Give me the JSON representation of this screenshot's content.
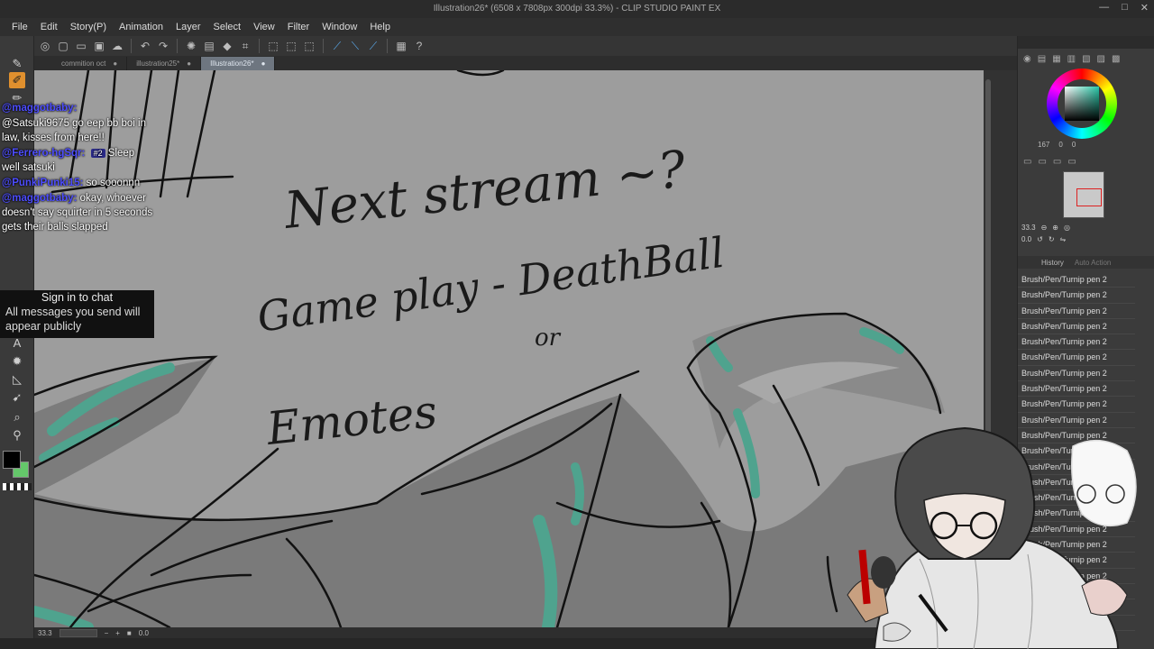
{
  "window": {
    "title": "Illustration26* (6508 x 7808px 300dpi 33.3%) - CLIP STUDIO PAINT EX",
    "controls": [
      "—",
      "□",
      "✕"
    ]
  },
  "menu": [
    "File",
    "Edit",
    "Story(P)",
    "Animation",
    "Layer",
    "Select",
    "View",
    "Filter",
    "Window",
    "Help"
  ],
  "tabs": [
    {
      "label": "commition oct",
      "mark": "●"
    },
    {
      "label": "illustration25*",
      "mark": "●"
    },
    {
      "label": "Illustration26*",
      "mark": "●"
    }
  ],
  "chat": {
    "messages": [
      {
        "user": "@maggotbaby:",
        "badge": "",
        "text": ""
      },
      {
        "user": "",
        "badge": "",
        "text": "@Satsuki9675 go eep bb boi in law, kisses from here!!"
      },
      {
        "user": "@Ferrero-hgSqr:",
        "badge": "#2",
        "text": "Sleep well satsuki"
      },
      {
        "user": "@PunkiPunki15:",
        "badge": "",
        "text": "so sooonnn"
      },
      {
        "user": "@maggotbaby:",
        "badge": "",
        "text": "okay, whoever doesn't say squirter in 5 seconds gets their balls slapped"
      }
    ],
    "signin_title": "Sign in to chat",
    "signin_note": "All messages you send will appear publicly"
  },
  "canvas_text": {
    "line1": "Next stream ~?",
    "line2": "Game play - DeathBall",
    "line3": "or",
    "line4": "Emotes"
  },
  "colors": {
    "foreground": "#000000",
    "background": "#64c76a",
    "canvas": "#9d9d9d",
    "accent_tab": "#6e7680",
    "teal_stroke": "#4fa38e"
  },
  "color_panel": {
    "h": "167",
    "s": "0",
    "v": "0"
  },
  "navigator": {
    "zoom": "33.3",
    "angle": "0.0"
  },
  "history": {
    "tab": "History",
    "tab2": "Auto Action",
    "items": [
      "Brush/Pen/Turnip pen 2",
      "Brush/Pen/Turnip pen 2",
      "Brush/Pen/Turnip pen 2",
      "Brush/Pen/Turnip pen 2",
      "Brush/Pen/Turnip pen 2",
      "Brush/Pen/Turnip pen 2",
      "Brush/Pen/Turnip pen 2",
      "Brush/Pen/Turnip pen 2",
      "Brush/Pen/Turnip pen 2",
      "Brush/Pen/Turnip pen 2",
      "Brush/Pen/Turnip pen 2",
      "Brush/Pen/Turnip pen 2",
      "Brush/Pen/Turnip pen 2",
      "Brush/Pen/Turnip pen 2",
      "Brush/Pen/Turnip pen 2",
      "Brush/Pen/Turnip pen 2",
      "Brush/Pen/Turnip pen 2",
      "Brush/Pen/Turnip pen 2",
      "Brush/Pen/Turnip pen 2",
      "Brush/Pen/Turnip pen 2",
      "Brush/Pen/Turnip pen 2",
      "Brush/Pen/Turnip pen 2",
      "Brush/Pen/Turnip pen 2"
    ]
  },
  "status": {
    "zoom": "33.3",
    "angle": "0.0"
  }
}
